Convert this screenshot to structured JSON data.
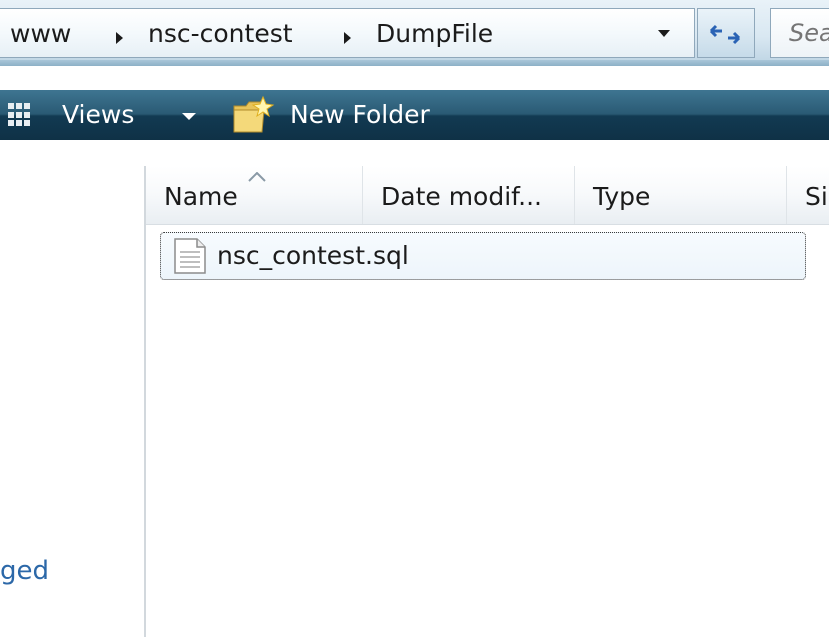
{
  "address_bar": {
    "breadcrumbs": [
      "www",
      "nsc-contest",
      "DumpFile"
    ]
  },
  "search": {
    "placeholder": "Search"
  },
  "command_bar": {
    "views_label": "Views",
    "new_folder_label": "New Folder"
  },
  "nav_pane": {
    "partial_link": "ged"
  },
  "file_list": {
    "columns": [
      "Name",
      "Date modif...",
      "Type",
      "Si"
    ],
    "sorted_by": "Name",
    "rows": [
      {
        "name": "nsc_contest.sql",
        "icon": "sql-file-icon"
      }
    ]
  },
  "colors": {
    "command_bar": "#1f4d66",
    "link": "#2c68a8"
  }
}
